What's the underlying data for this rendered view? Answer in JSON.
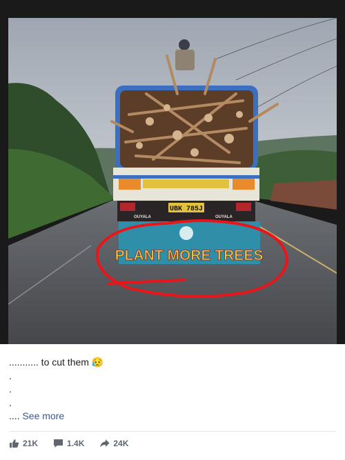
{
  "photo": {
    "truck_sign": "PLANT MORE TREES",
    "plate": "UBK 785J",
    "bumper_left": "OUYALA",
    "bumper_right": "OUYALA"
  },
  "post": {
    "caption_first": "........... to cut them",
    "caption_emoji": "😥",
    "caption_dots": [
      ".",
      ".",
      "."
    ],
    "caption_prefix": "....",
    "see_more": "See more"
  },
  "actions": {
    "likes": "21K",
    "comments": "1.4K",
    "shares": "24K"
  },
  "icons": [
    "like-icon",
    "comment-icon",
    "share-icon"
  ],
  "colors": {
    "link": "#385898",
    "text": "#1c1e21",
    "meta": "#606770",
    "circle": "#e8161b"
  }
}
